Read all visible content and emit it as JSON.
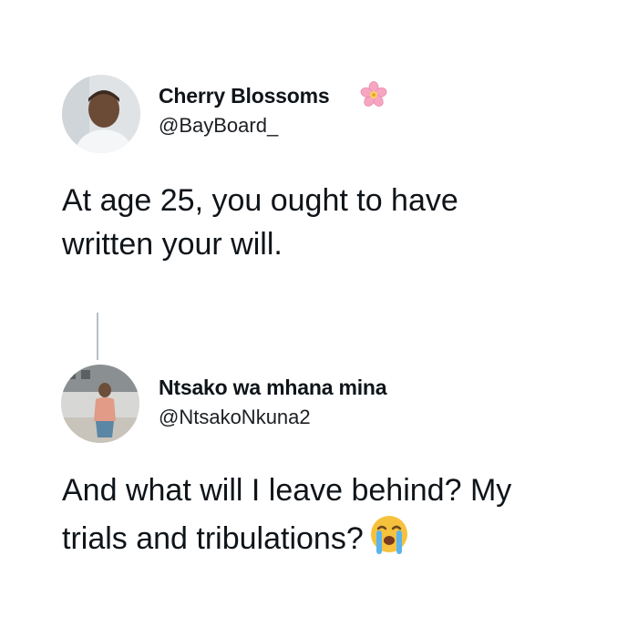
{
  "tweets": [
    {
      "author_name": "Cherry Blossoms",
      "author_handle": "@BayBoard_",
      "name_badge_icon": "cherry-blossom-emoji",
      "text_lines": [
        "At age 25, you ought to have",
        "written your will."
      ]
    },
    {
      "author_name": "Ntsako wa mhana mina",
      "author_handle": "@NtsakoNkuna2",
      "text_lines": [
        "And what will I leave behind? My",
        "trials and tribulations?"
      ],
      "trailing_emoji_icon": "loudly-crying-face-emoji"
    }
  ],
  "colors": {
    "text": "#0f1419",
    "connector": "#b8bec4",
    "background": "#ffffff"
  }
}
